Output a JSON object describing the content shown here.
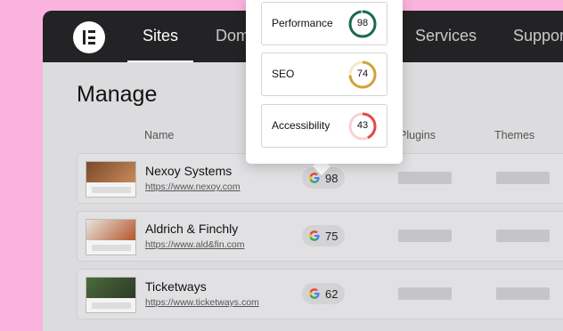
{
  "nav": {
    "items": [
      {
        "label": "Sites",
        "active": true
      },
      {
        "label": "Domains",
        "active": false
      },
      {
        "label": "Services",
        "active": false
      },
      {
        "label": "Support",
        "active": false
      }
    ]
  },
  "page": {
    "title": "Manage"
  },
  "table": {
    "headers": {
      "name": "Name",
      "plugins": "Plugins",
      "themes": "Themes"
    },
    "rows": [
      {
        "name": "Nexoy Systems",
        "url": "https://www.nexoy.com",
        "score": "98"
      },
      {
        "name": "Aldrich & Finchly",
        "url": "https://www.ald&fin.com",
        "score": "75"
      },
      {
        "name": "Ticketways",
        "url": "https://www.ticketways.com",
        "score": "62"
      }
    ]
  },
  "popup": {
    "metrics": [
      {
        "label": "Performance",
        "value": "98",
        "level": 0.98,
        "color": "#1d6b4a"
      },
      {
        "label": "SEO",
        "value": "74",
        "level": 0.74,
        "color": "#d4a23a"
      },
      {
        "label": "Accessibility",
        "value": "43",
        "level": 0.43,
        "color": "#e24a4a"
      }
    ]
  },
  "colors": {
    "navbar": "#232325",
    "background": "#f9b3de",
    "panel": "#dcdcde"
  },
  "icons": {
    "logo": "elementor-logo-icon",
    "score": "google-g-icon"
  }
}
